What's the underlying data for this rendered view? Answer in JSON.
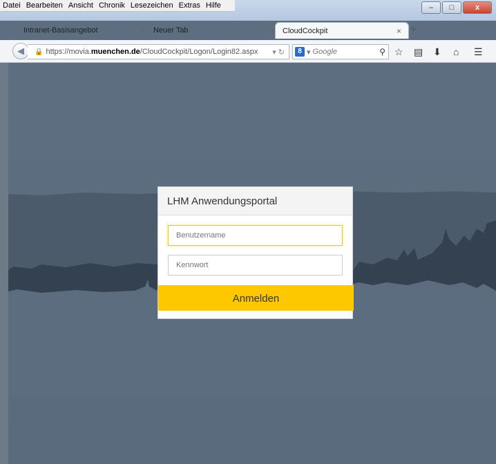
{
  "menu": [
    "Datei",
    "Bearbeiten",
    "Ansicht",
    "Chronik",
    "Lesezeichen",
    "Extras",
    "Hilfe"
  ],
  "window_controls": {
    "minimize": "–",
    "maximize": "□",
    "close": "x"
  },
  "tabs": [
    {
      "label": "Intranet-Basisangebot",
      "close": "×"
    },
    {
      "label": "Neuer Tab",
      "close": "×"
    },
    {
      "label": "CloudCockpit",
      "close": "×",
      "active": true
    }
  ],
  "newtab_label": "+",
  "address": {
    "prefix": "https://movia.",
    "domain": "muenchen.de",
    "path": "/CloudCockpit/Logon/Login82.aspx"
  },
  "search": {
    "engine_icon": "8",
    "placeholder": "Google"
  },
  "login": {
    "title": "LHM Anwendungsportal",
    "username_placeholder": "Benutzername",
    "password_placeholder": "Kennwort",
    "submit_label": "Anmelden"
  },
  "colors": {
    "background": "#5d6e80",
    "accent": "#fec801"
  }
}
